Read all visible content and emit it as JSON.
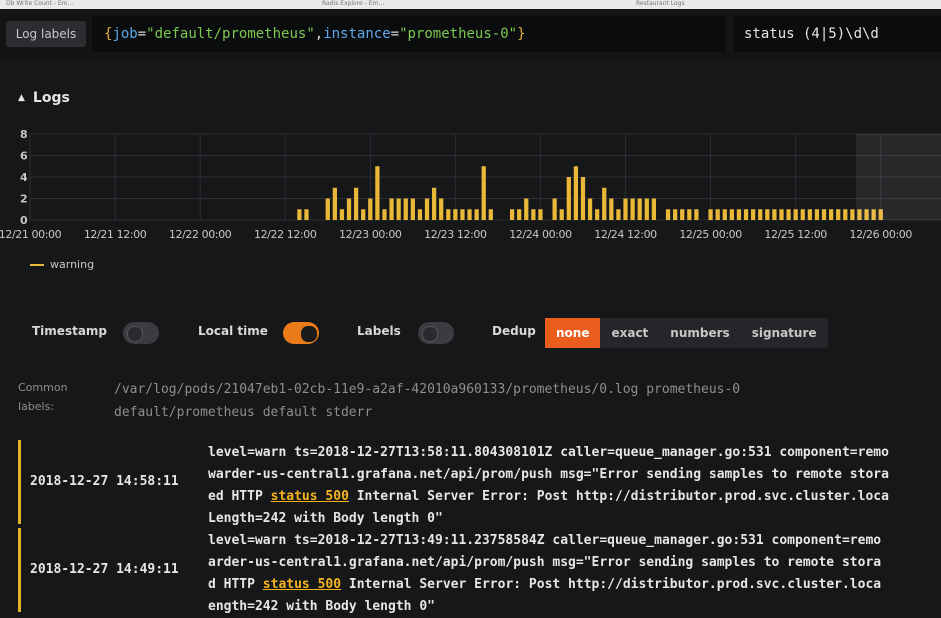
{
  "browser_tabs": [
    "Db Write Count - Em…",
    "Radis Explore - Em…",
    "Restaurant Logs"
  ],
  "query": {
    "log_labels_button": "Log labels",
    "brace_open": "{",
    "label1": "job",
    "op1": "=",
    "value1": "\"default/prometheus\"",
    "comma": ",",
    "label2": "instance",
    "op2": "=",
    "value2": "\"prometheus-0\"",
    "brace_close": "}",
    "filter": "status (4|5)\\d\\d"
  },
  "logs": {
    "title": "Logs",
    "legend": "warning"
  },
  "colors": {
    "warning": "#eab839",
    "accent": "#eb5d1c",
    "toggle_on": "#eb7b18",
    "background": "#161719"
  },
  "chart_data": {
    "type": "bar",
    "ylim": [
      0,
      8
    ],
    "yticks": [
      0,
      2,
      4,
      6,
      8
    ],
    "xticks": [
      "12/21 00:00",
      "12/21 12:00",
      "12/22 00:00",
      "12/22 12:00",
      "12/23 00:00",
      "12/23 12:00",
      "12/24 00:00",
      "12/24 12:00",
      "12/25 00:00",
      "12/25 12:00",
      "12/26 00:00"
    ],
    "x_range_hours": [
      0,
      128.5
    ],
    "series": [
      {
        "name": "warning",
        "color": "#eab839",
        "x": [
          38,
          39,
          42,
          43,
          44,
          45,
          46,
          47,
          48,
          49,
          50,
          51,
          52,
          53,
          54,
          55,
          56,
          57,
          58,
          59,
          60,
          61,
          62,
          63,
          64,
          65,
          68,
          69,
          70,
          71,
          72,
          74,
          75,
          76,
          77,
          78,
          79,
          80,
          81,
          82,
          83,
          84,
          85,
          86,
          87,
          88,
          90,
          91,
          92,
          93,
          94,
          96,
          97,
          98,
          99,
          100,
          101,
          102,
          103,
          104,
          105,
          106,
          107,
          108,
          109,
          110,
          111,
          112,
          113,
          114,
          115,
          116,
          117,
          118,
          119,
          120
        ],
        "values": [
          1,
          1,
          2,
          3,
          1,
          2,
          3,
          1,
          2,
          5,
          1,
          2,
          2,
          2,
          2,
          1,
          2,
          3,
          2,
          1,
          1,
          1,
          1,
          1,
          5,
          1,
          1,
          1,
          2,
          1,
          1,
          2,
          1,
          4,
          5,
          4,
          2,
          1,
          3,
          2,
          1,
          2,
          2,
          2,
          2,
          2,
          1,
          1,
          1,
          1,
          1,
          1,
          1,
          1,
          1,
          1,
          1,
          1,
          1,
          1,
          1,
          1,
          1,
          1,
          1,
          1,
          1,
          1,
          1,
          1,
          1,
          1,
          1,
          1,
          1,
          1
        ]
      }
    ]
  },
  "options": {
    "timestamp_label": "Timestamp",
    "local_time_label": "Local time",
    "labels_label": "Labels",
    "dedup_label": "Dedup",
    "dedup_options": [
      "none",
      "exact",
      "numbers",
      "signature"
    ]
  },
  "common_labels": {
    "title": "Common labels:",
    "line1": "/var/log/pods/21047eb1-02cb-11e9-a2af-42010a960133/prometheus/0.log prometheus-0",
    "line2": "default/prometheus default stderr"
  },
  "rows": [
    {
      "timestamp": "2018-12-27 14:58:11",
      "line1": "level=warn ts=2018-12-27T13:58:11.804308101Z caller=queue_manager.go:531 component=remo",
      "line2": "warder-us-central1.grafana.net/api/prom/push msg=\"Error sending samples to remote stora",
      "line3_pre": "ed HTTP ",
      "highlight": "status 500",
      "line3_post": " Internal Server Error: Post http://distributor.prod.svc.cluster.loca",
      "line4": "Length=242 with Body length 0\""
    },
    {
      "timestamp": "2018-12-27 14:49:11",
      "line1": "level=warn ts=2018-12-27T13:49:11.23758584Z caller=queue_manager.go:531 component=remo",
      "line2": "arder-us-central1.grafana.net/api/prom/push msg=\"Error sending samples to remote stora",
      "line3_pre": "d HTTP ",
      "highlight": "status 500",
      "line3_post": " Internal Server Error: Post http://distributor.prod.svc.cluster.loca",
      "line4": "ength=242 with Body length 0\""
    }
  ]
}
